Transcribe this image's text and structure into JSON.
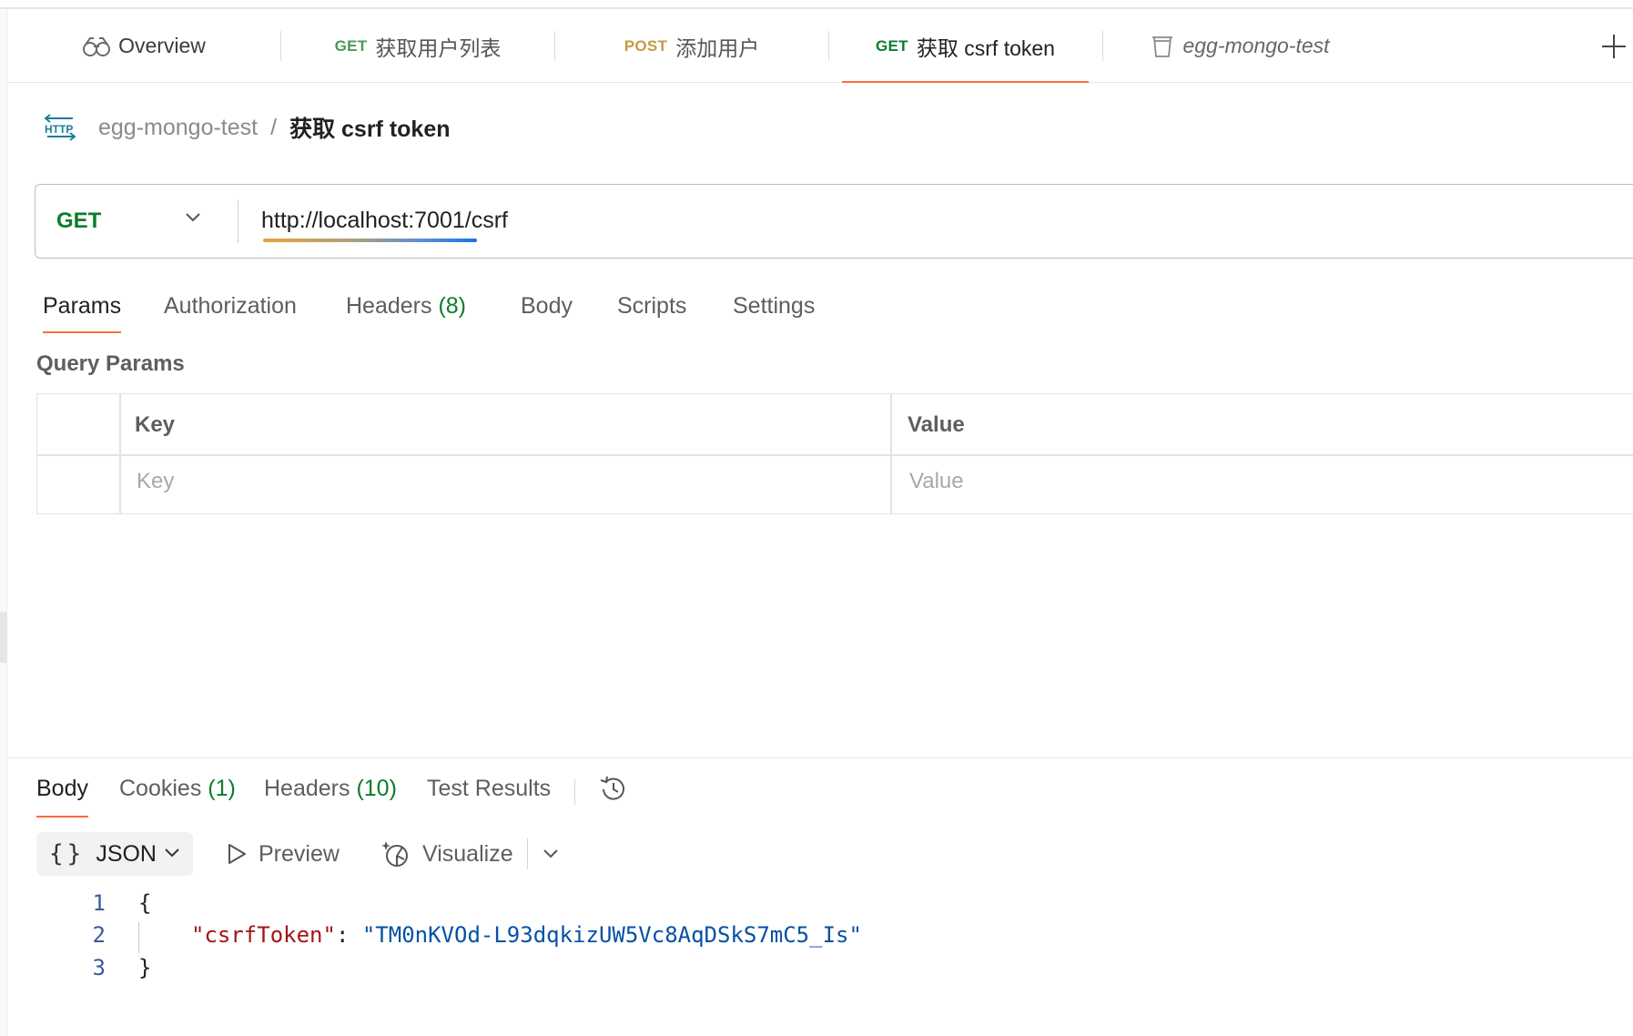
{
  "tabs": [
    {
      "method": "",
      "label": "Overview",
      "icon": "overview-icon"
    },
    {
      "method": "GET",
      "label": "获取用户列表"
    },
    {
      "method": "POST",
      "label": "添加用户"
    },
    {
      "method": "GET",
      "label": "获取 csrf token",
      "active": true
    },
    {
      "method": "",
      "label": "egg-mongo-test",
      "icon": "collection-icon"
    }
  ],
  "breadcrumb": {
    "icon": "http-icon",
    "collection": "egg-mongo-test",
    "separator": "/",
    "request": "获取 csrf token"
  },
  "request": {
    "method": "GET",
    "url": "http://localhost:7001/csrf"
  },
  "request_tabs": [
    {
      "label": "Params",
      "active": true
    },
    {
      "label": "Authorization"
    },
    {
      "label": "Headers",
      "count": "(8)"
    },
    {
      "label": "Body"
    },
    {
      "label": "Scripts"
    },
    {
      "label": "Settings"
    }
  ],
  "query_params": {
    "title": "Query Params",
    "headers": {
      "key": "Key",
      "value": "Value"
    },
    "placeholders": {
      "key": "Key",
      "value": "Value"
    }
  },
  "response_tabs": [
    {
      "label": "Body",
      "active": true
    },
    {
      "label": "Cookies",
      "count": "(1)"
    },
    {
      "label": "Headers",
      "count": "(10)"
    },
    {
      "label": "Test Results"
    }
  ],
  "response_toolbar": {
    "format_braces": "{}",
    "format": "JSON",
    "preview": "Preview",
    "visualize": "Visualize"
  },
  "response_body": {
    "lines": [
      "1",
      "2",
      "3"
    ],
    "open_brace": "{",
    "key": "\"csrfToken\"",
    "colon": ": ",
    "value": "\"TM0nKVOd-L93dqkizUW5Vc8AqDSkS7mC5_Is\"",
    "close_brace": "}"
  },
  "colors": {
    "accent": "#ff6c37",
    "get": "#0b7d2c",
    "post": "#c49a45",
    "json_key": "#a31515",
    "json_string": "#0451a5"
  }
}
